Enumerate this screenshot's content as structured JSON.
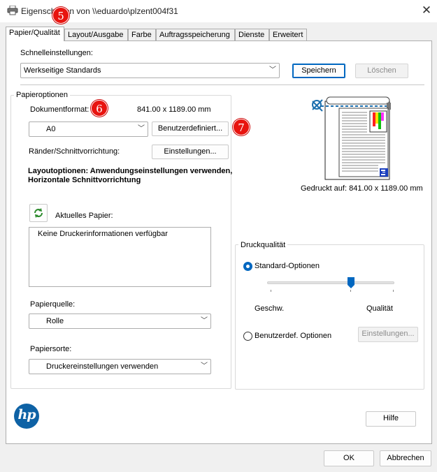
{
  "window": {
    "title": "Eigenschaften von \\\\eduardo\\plzent004f31",
    "close_label": "✕"
  },
  "badges": [
    "5",
    "6",
    "7"
  ],
  "tabs": [
    {
      "label": "Papier/Qualität",
      "active": true
    },
    {
      "label": "Layout/Ausgabe"
    },
    {
      "label": "Farbe"
    },
    {
      "label": "Auftragsspeicherung"
    },
    {
      "label": "Dienste"
    },
    {
      "label": "Erweitert"
    }
  ],
  "quick_settings": {
    "label": "Schnelleinstellungen:",
    "selected": "Werkseitige Standards",
    "save_label": "Speichern",
    "delete_label": "Löschen"
  },
  "paper_options": {
    "legend": "Papieroptionen",
    "doc_format_label": "Dokumentformat:",
    "doc_format_size": "841.00 x 1189.00 mm",
    "format_selected": "A0",
    "custom_label": "Benutzerdefiniert...",
    "margins_label": "Ränder/Schnittvorrichtung:",
    "margins_settings_label": "Einstellungen...",
    "layout_text_1": "Layoutoptionen: Anwendungseinstellungen verwenden,",
    "layout_text_2": "Horizontale Schnittvorrichtung",
    "current_paper_label": "Aktuelles Papier:",
    "printer_info": "Keine Druckerinformationen verfügbar",
    "source_label": "Papierquelle:",
    "source_selected": "Rolle",
    "type_label": "Papiersorte:",
    "type_selected": "Druckereinstellungen verwenden"
  },
  "preview": {
    "printed_on": "Gedruckt auf: 841.00 x 1189.00 mm"
  },
  "quality": {
    "legend": "Druckqualität",
    "standard_label": "Standard-Optionen",
    "speed_label": "Geschw.",
    "quality_label": "Qualität",
    "custom_label": "Benutzerdef. Optionen",
    "custom_settings_label": "Einstellungen...",
    "slider_value": 0.66
  },
  "logo_text": "hp",
  "help_label": "Hilfe",
  "ok_label": "OK",
  "cancel_label": "Abbrechen",
  "colors": {
    "accent": "#0067c0",
    "badge": "#e8140f",
    "hp_blue": "#0e62a5"
  }
}
